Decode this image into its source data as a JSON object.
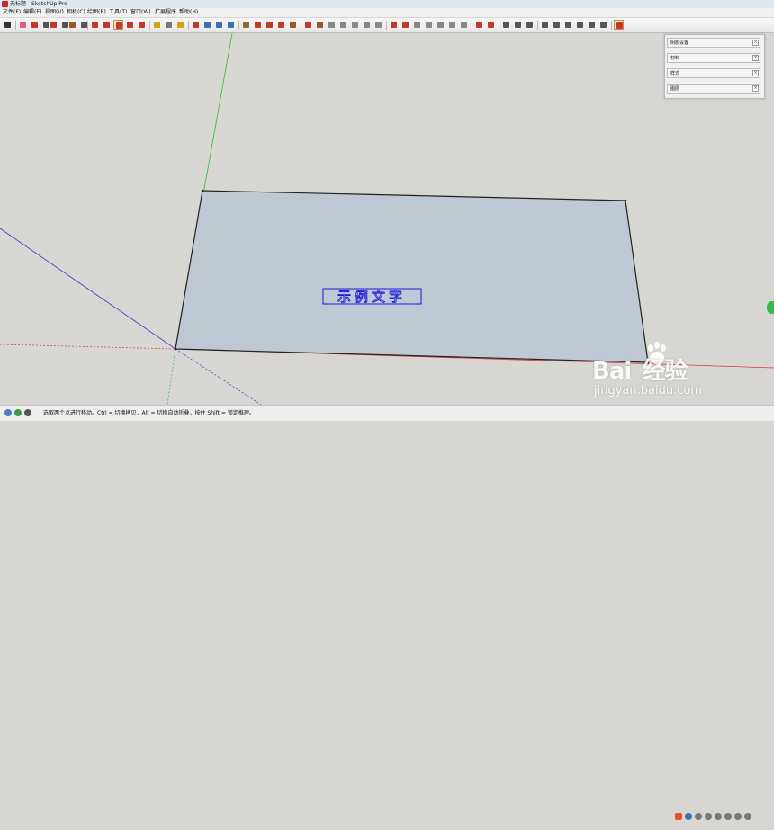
{
  "window": {
    "title": "无标题 - SketchUp Pro"
  },
  "menu": [
    {
      "label": "文件(F)"
    },
    {
      "label": "编辑(E)"
    },
    {
      "label": "视图(V)"
    },
    {
      "label": "相机(C)"
    },
    {
      "label": "绘图(R)"
    },
    {
      "label": "工具(T)"
    },
    {
      "label": "窗口(W)"
    },
    {
      "label": "扩展程序"
    },
    {
      "label": "帮助(H)"
    }
  ],
  "toolbar": {
    "tools": [
      {
        "icon": "select-arrow-icon",
        "color": "#333333"
      },
      {
        "icon": "eraser-icon",
        "color": "#e35a8f"
      },
      {
        "icon": "pencil-icon",
        "color": "#c0392b"
      },
      {
        "icon": "dropdown-icon",
        "color": "#555555"
      },
      {
        "icon": "arc-icon",
        "color": "#c0392b"
      },
      {
        "icon": "dropdown-icon",
        "color": "#555555"
      },
      {
        "icon": "rectangle-icon",
        "color": "#a0522d"
      },
      {
        "icon": "dropdown-icon",
        "color": "#555555"
      },
      {
        "icon": "push-pull-icon",
        "color": "#c0392b"
      },
      {
        "icon": "offset-icon",
        "color": "#c0392b"
      },
      {
        "icon": "move-icon",
        "color": "#c0392b",
        "selected": true
      },
      {
        "icon": "rotate-icon",
        "color": "#c0392b"
      },
      {
        "icon": "scale-icon",
        "color": "#c0392b"
      },
      {
        "icon": "tape-measure-icon",
        "color": "#d4a017"
      },
      {
        "icon": "text-icon",
        "color": "#777777"
      },
      {
        "icon": "paint-bucket-icon",
        "color": "#d4a017"
      },
      {
        "icon": "orbit-icon",
        "color": "#c0392b"
      },
      {
        "icon": "pan-icon",
        "color": "#3a6fb0"
      },
      {
        "icon": "zoom-icon",
        "color": "#3a6fb0"
      },
      {
        "icon": "zoom-extents-icon",
        "color": "#3a6fb0"
      },
      {
        "icon": "warehouse-icon",
        "color": "#8a6d3b"
      },
      {
        "icon": "extension-warehouse-icon",
        "color": "#c0392b"
      },
      {
        "icon": "send-to-layout-icon",
        "color": "#c0392b"
      },
      {
        "icon": "components-icon",
        "color": "#c0392b"
      },
      {
        "icon": "section-icon",
        "color": "#a0522d"
      },
      {
        "icon": "follow-me-icon",
        "color": "#c0392b"
      },
      {
        "icon": "intersect-icon",
        "color": "#a0522d"
      },
      {
        "icon": "outer-shell-icon",
        "color": "#888888"
      },
      {
        "icon": "union-icon",
        "color": "#888888"
      },
      {
        "icon": "subtract-icon",
        "color": "#888888"
      },
      {
        "icon": "trim-icon",
        "color": "#888888"
      },
      {
        "icon": "split-icon",
        "color": "#888888"
      },
      {
        "icon": "sandbox-contours-icon",
        "color": "#c0392b"
      },
      {
        "icon": "sandbox-scratch-icon",
        "color": "#c0392b"
      },
      {
        "icon": "smoove-icon",
        "color": "#888888"
      },
      {
        "icon": "stamp-icon",
        "color": "#888888"
      },
      {
        "icon": "drape-icon",
        "color": "#888888"
      },
      {
        "icon": "add-detail-icon",
        "color": "#888888"
      },
      {
        "icon": "flip-edge-icon",
        "color": "#888888"
      },
      {
        "icon": "solar-north-icon",
        "color": "#c0392b"
      },
      {
        "icon": "make-component-icon",
        "color": "#c0392b"
      },
      {
        "icon": "profile-icon",
        "color": "#555555"
      },
      {
        "icon": "shadow-icon",
        "color": "#555555"
      },
      {
        "icon": "x-ray-icon",
        "color": "#555555"
      },
      {
        "icon": "back-edges-icon",
        "color": "#555555"
      },
      {
        "icon": "wireframe-icon",
        "color": "#555555"
      },
      {
        "icon": "hidden-line-icon",
        "color": "#555555"
      },
      {
        "icon": "shaded-icon",
        "color": "#555555"
      },
      {
        "icon": "shaded-textures-icon",
        "color": "#555555"
      },
      {
        "icon": "monochrome-icon",
        "color": "#555555"
      },
      {
        "icon": "ruby-console-icon",
        "color": "#c0392b",
        "selected": true
      }
    ]
  },
  "tray": {
    "panels": [
      {
        "label": "阴影设置"
      },
      {
        "label": "材料"
      },
      {
        "label": "样式"
      },
      {
        "label": "图层"
      }
    ],
    "close_glyph": "×"
  },
  "canvas": {
    "face_color": "#bec9d3",
    "edge_color": "#222222",
    "text_3d": "示例文字",
    "axis_green": "#35b535",
    "axis_blue": "#3a3ad0",
    "axis_red": "#d43a3a"
  },
  "status": {
    "text": "选取两个点进行移动。Ctrl = 切换拷贝，Alt = 切换自动折叠，按住 Shift = 锁定推理。"
  },
  "watermark": {
    "brand": "Bai  经验",
    "url": "jingyan.baidu.com"
  }
}
